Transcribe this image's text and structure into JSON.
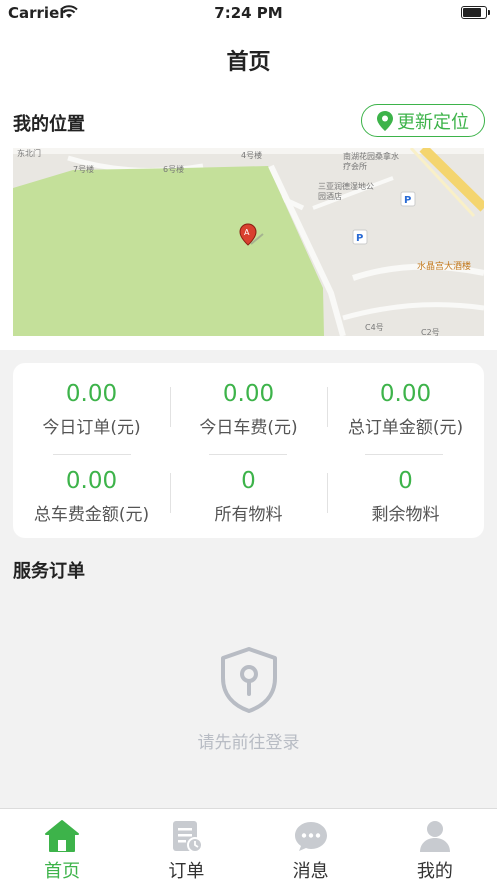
{
  "status_bar": {
    "carrier": "Carrier",
    "time": "7:24 PM"
  },
  "nav": {
    "title": "首页"
  },
  "location": {
    "title": "我的位置",
    "locate_button": "更新定位",
    "map_labels": {
      "road1": "东北门",
      "b7": "7号楼",
      "b6": "6号楼",
      "b4": "4号楼",
      "spa": "南湖花园桑拿水疗会所",
      "hotel": "三亚润德湿地公园酒店",
      "restaurant": "水晶宫大酒楼",
      "c4": "C4号",
      "c2": "C2号"
    }
  },
  "stats": [
    {
      "value": "0.00",
      "label": "今日订单(元)"
    },
    {
      "value": "0.00",
      "label": "今日车费(元)"
    },
    {
      "value": "0.00",
      "label": "总订单金额(元)"
    },
    {
      "value": "0.00",
      "label": "总车费金额(元)"
    },
    {
      "value": "0",
      "label": "所有物料"
    },
    {
      "value": "0",
      "label": "剩余物料"
    }
  ],
  "orders": {
    "title": "服务订单",
    "empty_message": "请先前往登录"
  },
  "tabs": [
    {
      "label": "首页",
      "icon": "home-icon",
      "active": true
    },
    {
      "label": "订单",
      "icon": "order-icon",
      "active": false
    },
    {
      "label": "消息",
      "icon": "message-icon",
      "active": false
    },
    {
      "label": "我的",
      "icon": "profile-icon",
      "active": false
    }
  ],
  "colors": {
    "accent": "#3db34a",
    "map_park": "#c4e09a"
  }
}
